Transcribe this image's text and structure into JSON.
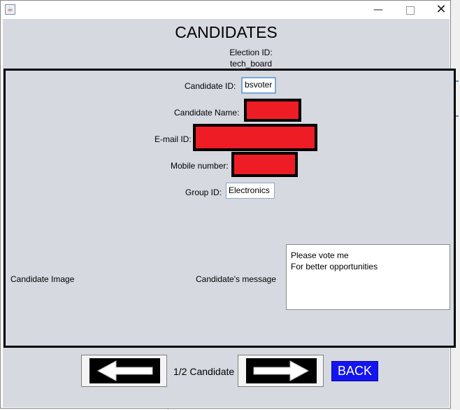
{
  "window": {
    "app_icon": "java-icon",
    "controls": {
      "minimize": "—",
      "maximize": "",
      "close": "✕"
    }
  },
  "header": {
    "title": "CANDIDATES",
    "election_label": "Election ID:",
    "election_value": "tech_board"
  },
  "form": {
    "candidate_id_label": "Candidate ID:",
    "candidate_id_value": "bsvoter",
    "candidate_name_label": "Candidate Name:",
    "email_label": "E-mail ID:",
    "mobile_label": "Mobile number:",
    "group_id_label": "Group ID:",
    "group_id_value": "Electronics",
    "image_label": "Candidate Image",
    "message_label": "Candidate's message",
    "message_lines": [
      "Please vote me",
      "For better opportunities"
    ]
  },
  "footer": {
    "prev_icon": "left-arrow-icon",
    "next_icon": "right-arrow-icon",
    "page_indicator": "1/2 Candidate",
    "back_label": "BACK"
  },
  "colors": {
    "panel_bg": "#d6d9e0",
    "redaction": "#ee1c25",
    "back_button": "#1414f0"
  }
}
